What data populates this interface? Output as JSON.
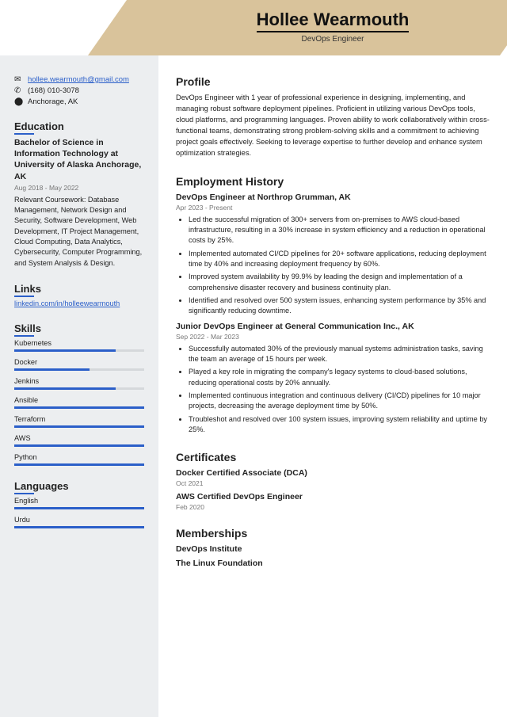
{
  "header": {
    "name": "Hollee Wearmouth",
    "title": "DevOps Engineer"
  },
  "contact": {
    "email": "hollee.wearmouth@gmail.com",
    "phone": "(168) 010-3078",
    "location": "Anchorage, AK"
  },
  "education": {
    "heading": "Education",
    "degree": "Bachelor of Science in Information Technology at University of Alaska Anchorage, AK",
    "dates": "Aug 2018 - May 2022",
    "coursework": "Relevant Coursework: Database Management, Network Design and Security, Software Development, Web Development, IT Project Management, Cloud Computing, Data Analytics, Cybersecurity, Computer Programming, and System Analysis & Design."
  },
  "links": {
    "heading": "Links",
    "linkedin": "linkedin.com/in/holleewearmouth"
  },
  "skills": {
    "heading": "Skills",
    "items": [
      {
        "name": "Kubernetes",
        "level": 78
      },
      {
        "name": "Docker",
        "level": 58
      },
      {
        "name": "Jenkins",
        "level": 78
      },
      {
        "name": "Ansible",
        "level": 100
      },
      {
        "name": "Terraform",
        "level": 100
      },
      {
        "name": "AWS",
        "level": 100
      },
      {
        "name": "Python",
        "level": 100
      }
    ]
  },
  "languages": {
    "heading": "Languages",
    "items": [
      {
        "name": "English",
        "level": 100
      },
      {
        "name": "Urdu",
        "level": 100
      }
    ]
  },
  "profile": {
    "heading": "Profile",
    "text": "DevOps Engineer with 1 year of professional experience in designing, implementing, and managing robust software deployment pipelines. Proficient in utilizing various DevOps tools, cloud platforms, and programming languages. Proven ability to work collaboratively within cross-functional teams, demonstrating strong problem-solving skills and a commitment to achieving project goals effectively. Seeking to leverage expertise to further develop and enhance system optimization strategies."
  },
  "employment": {
    "heading": "Employment History",
    "jobs": [
      {
        "title": "DevOps Engineer at Northrop Grumman, AK",
        "dates": "Apr 2023 - Present",
        "bullets": [
          "Led the successful migration of 300+ servers from on-premises to AWS cloud-based infrastructure, resulting in a 30% increase in system efficiency and a reduction in operational costs by 25%.",
          "Implemented automated CI/CD pipelines for 20+ software applications, reducing deployment time by 40% and increasing deployment frequency by 60%.",
          "Improved system availability by 99.9% by leading the design and implementation of a comprehensive disaster recovery and business continuity plan.",
          "Identified and resolved over 500 system issues, enhancing system performance by 35% and significantly reducing downtime."
        ]
      },
      {
        "title": "Junior DevOps Engineer at General Communication Inc., AK",
        "dates": "Sep 2022 - Mar 2023",
        "bullets": [
          "Successfully automated 30% of the previously manual systems administration tasks, saving the team an average of 15 hours per week.",
          "Played a key role in migrating the company's legacy systems to cloud-based solutions, reducing operational costs by 20% annually.",
          "Implemented continuous integration and continuous delivery (CI/CD) pipelines for 10 major projects, decreasing the average deployment time by 50%.",
          "Troubleshot and resolved over 100 system issues, improving system reliability and uptime by 25%."
        ]
      }
    ]
  },
  "certificates": {
    "heading": "Certificates",
    "items": [
      {
        "title": "Docker Certified Associate (DCA)",
        "date": "Oct 2021"
      },
      {
        "title": "AWS Certified DevOps Engineer",
        "date": "Feb 2020"
      }
    ]
  },
  "memberships": {
    "heading": "Memberships",
    "items": [
      "DevOps Institute",
      "The Linux Foundation"
    ]
  }
}
